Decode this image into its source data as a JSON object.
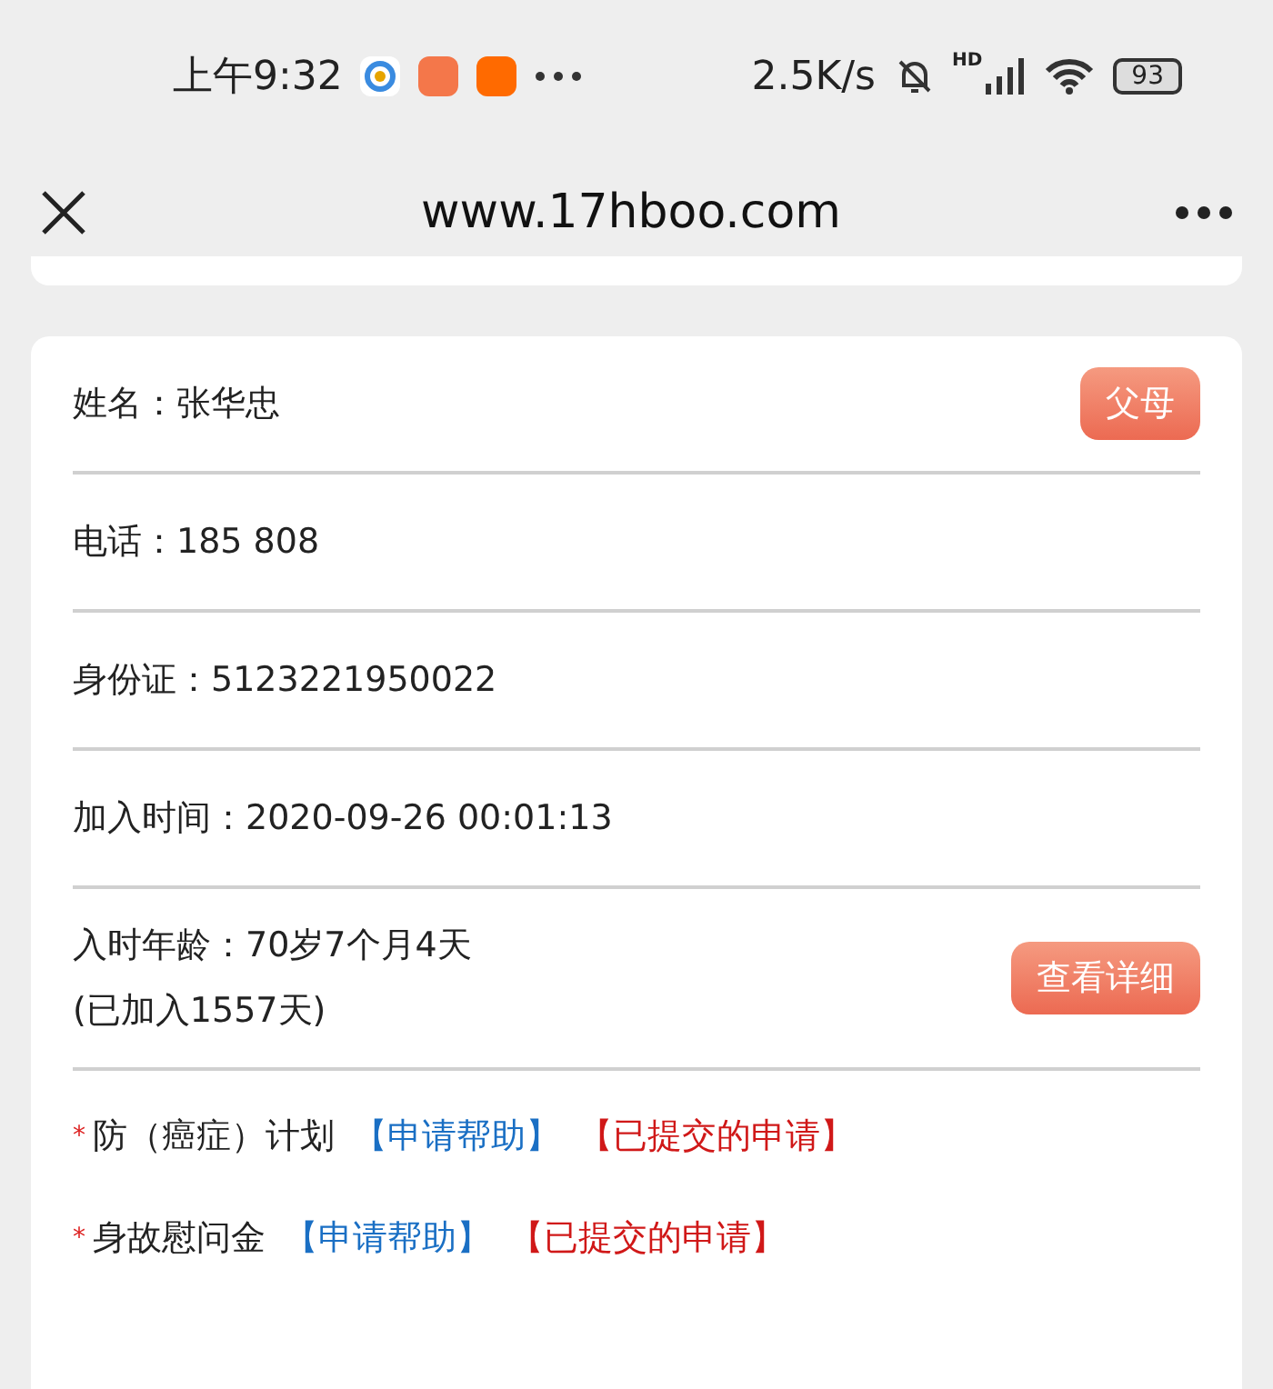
{
  "status_bar": {
    "time": "上午9:32",
    "speed": "2.5K/s",
    "network": "HD",
    "battery": "93"
  },
  "browser": {
    "url": "www.17hboo.com"
  },
  "fields": [
    {
      "label": "姓名：",
      "value": "张华忠",
      "button": "父母"
    },
    {
      "label": "电话：",
      "value": "185 808"
    },
    {
      "label": "身份证：",
      "value": "5123221950022"
    },
    {
      "label": "加入时间：",
      "value": "2020-09-26 00:01:13"
    },
    {
      "label": "入时年龄：",
      "value": "70岁7个月4天",
      "note": "(已加入1557天)",
      "button": "查看详细"
    }
  ],
  "plans": [
    {
      "mark": "*",
      "name": "防（癌症）计划",
      "apply": "【申请帮助】",
      "submitted": "【已提交的申请】"
    },
    {
      "mark": "*",
      "name": "身故慰问金",
      "apply": "【申请帮助】",
      "submitted": "【已提交的申请】"
    }
  ]
}
